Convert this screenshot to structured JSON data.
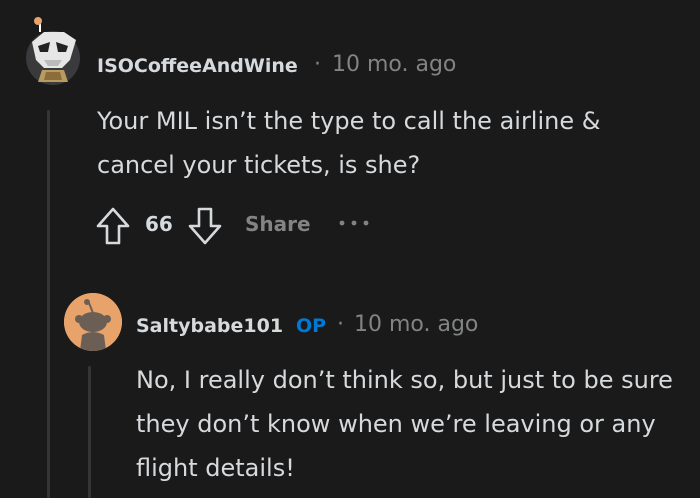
{
  "comments": [
    {
      "username": "ISOCoffeeAndWine",
      "separator": "·",
      "time": "10 mo. ago",
      "body": "Your MIL isn’t the type to call the airline & cancel your tickets, is she?",
      "votes": "66",
      "share_label": "Share",
      "more_label": "•••"
    },
    {
      "username": "Saltybabe101",
      "op_badge": "OP",
      "separator": "·",
      "time": "10 mo. ago",
      "body": "No, I really don’t think so, but just to be sure they don’t know when we’re leaving or any flight details!"
    }
  ],
  "icons": {
    "upvote": "upvote-arrow-icon",
    "downvote": "downvote-arrow-icon"
  },
  "colors": {
    "background": "#1a1a1b",
    "text": "#d7dadc",
    "muted": "#818384",
    "op_blue": "#0079d3",
    "thread_line": "#343536",
    "avatar2_bg": "#e8a36a"
  }
}
